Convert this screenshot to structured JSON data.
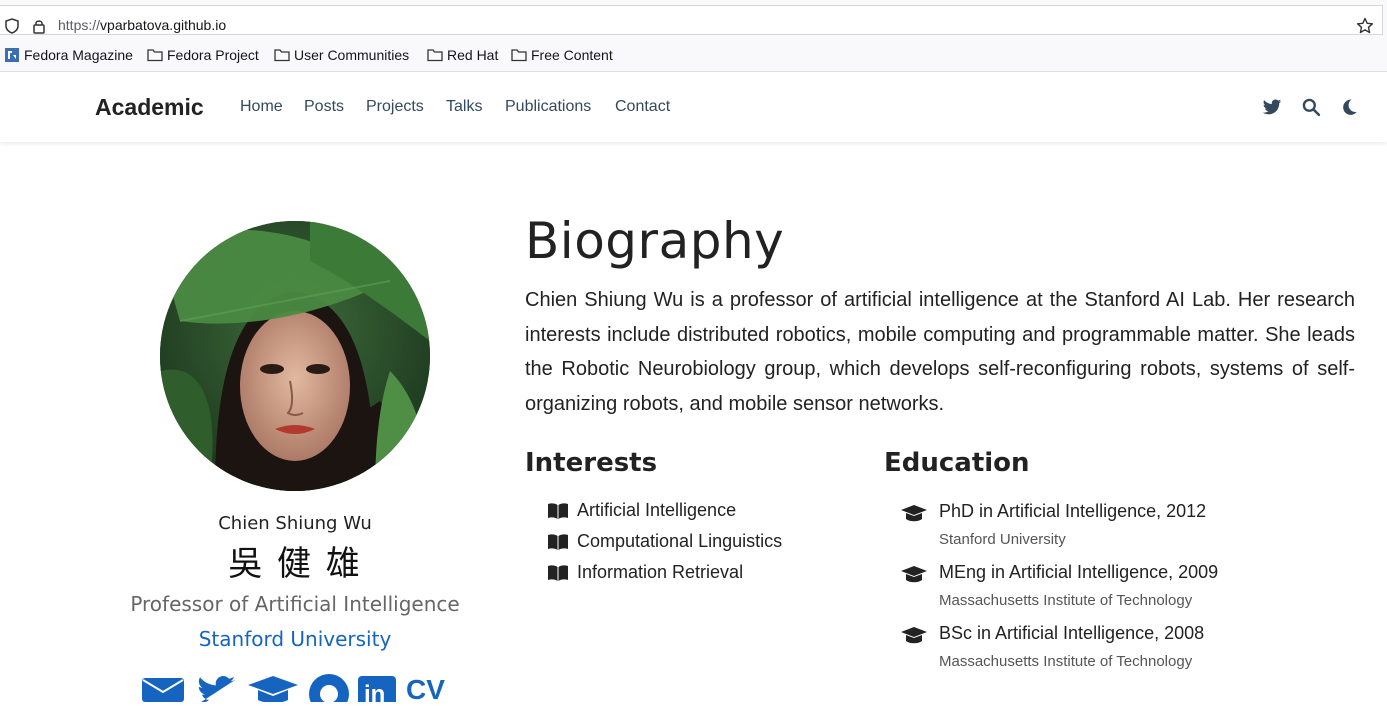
{
  "browser": {
    "url_scheme": "https://",
    "url_host": "vparbatova.github.io",
    "bookmarks": [
      "Fedora Magazine",
      "Fedora Project",
      "User Communities",
      "Red Hat",
      "Free Content"
    ]
  },
  "nav": {
    "brand": "Academic",
    "links": [
      "Home",
      "Posts",
      "Projects",
      "Talks",
      "Publications",
      "Contact"
    ],
    "icons": [
      "twitter-icon",
      "search-icon",
      "moon-icon"
    ]
  },
  "profile": {
    "name": "Chien Shiung Wu",
    "name_cjk": "吳 健 雄",
    "role": "Professor of Artificial Intelligence",
    "organization": "Stanford University",
    "social_icons": [
      "envelope-icon",
      "twitter-icon",
      "graduation-cap-icon",
      "github-icon",
      "linkedin-icon",
      "cv-icon"
    ],
    "cv_label": "CV"
  },
  "biography": {
    "title": "Biography",
    "text": "Chien Shiung Wu is a professor of artificial intelligence at the Stanford AI Lab. Her research interests include distributed robotics, mobile computing and programmable matter. She leads the Robotic Neurobiology group, which develops self-reconfiguring robots, systems of self-organizing robots, and mobile sensor networks."
  },
  "interests": {
    "title": "Interests",
    "items": [
      "Artificial Intelligence",
      "Computational Linguistics",
      "Information Retrieval"
    ]
  },
  "education": {
    "title": "Education",
    "items": [
      {
        "degree": "PhD in Artificial Intelligence, 2012",
        "institution": "Stanford University"
      },
      {
        "degree": "MEng in Artificial Intelligence, 2009",
        "institution": "Massachusetts Institute of Technology"
      },
      {
        "degree": "BSc in Artificial Intelligence, 2008",
        "institution": "Massachusetts Institute of Technology"
      }
    ]
  },
  "colors": {
    "accent": "#1565c0",
    "nav_text": "#34495e",
    "muted": "#666666"
  }
}
